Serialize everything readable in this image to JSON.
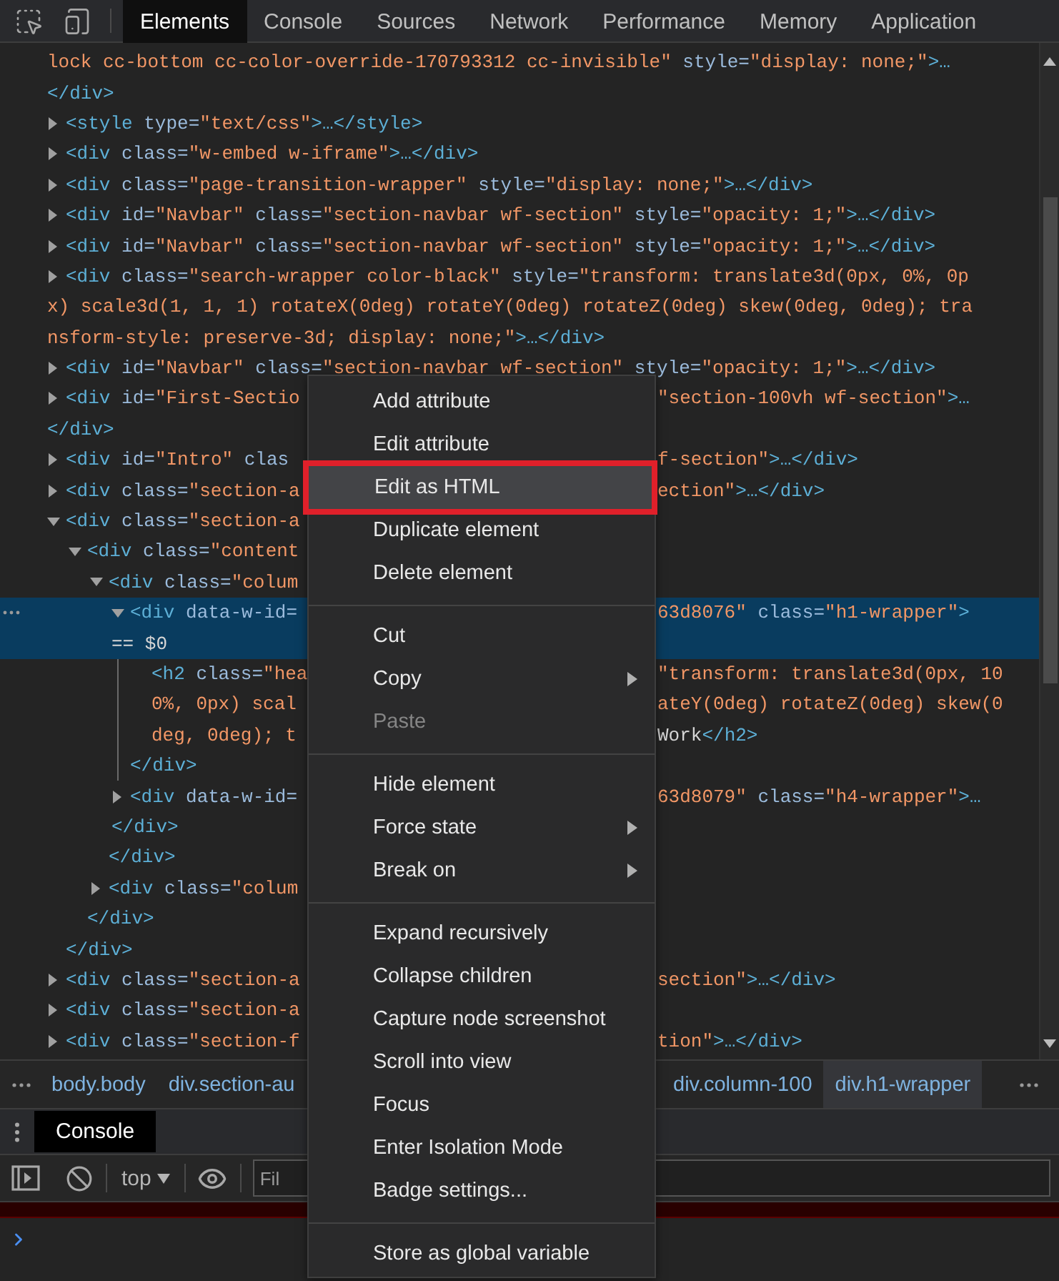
{
  "tabs": [
    {
      "label": "Elements",
      "selected": true
    },
    {
      "label": "Console",
      "selected": false
    },
    {
      "label": "Sources",
      "selected": false
    },
    {
      "label": "Network",
      "selected": false
    },
    {
      "label": "Performance",
      "selected": false
    },
    {
      "label": "Memory",
      "selected": false
    },
    {
      "label": "Application",
      "selected": false
    }
  ],
  "dom_tree": [
    {
      "continued": true,
      "selected": false,
      "lines": [
        {
          "left": [
            {
              "kind": "val",
              "text": "lock cc-bottom cc-color-override-170793312 cc-invisible\""
            },
            {
              "kind": "attr",
              "text": " style="
            },
            {
              "kind": "val",
              "text": "\"display: none;\""
            },
            {
              "kind": "tag",
              "text": ">…"
            }
          ]
        },
        {
          "left": [
            {
              "kind": "tag",
              "text": "</div>"
            }
          ]
        }
      ]
    },
    {
      "expanded": false,
      "selected": false,
      "lines": [
        {
          "left": [
            {
              "kind": "tag",
              "text": "<style"
            },
            {
              "kind": "attr",
              "text": " type="
            },
            {
              "kind": "val",
              "text": "\"text/css\""
            },
            {
              "kind": "tag",
              "text": ">…</style>"
            }
          ]
        }
      ]
    },
    {
      "expanded": false,
      "selected": false,
      "lines": [
        {
          "left": [
            {
              "kind": "tag",
              "text": "<div"
            },
            {
              "kind": "attr",
              "text": " class="
            },
            {
              "kind": "val",
              "text": "\"w-embed w-iframe\""
            },
            {
              "kind": "tag",
              "text": ">…</div>"
            }
          ]
        }
      ]
    },
    {
      "expanded": false,
      "selected": false,
      "lines": [
        {
          "left": [
            {
              "kind": "tag",
              "text": "<div"
            },
            {
              "kind": "attr",
              "text": " class="
            },
            {
              "kind": "val",
              "text": "\"page-transition-wrapper\""
            },
            {
              "kind": "attr",
              "text": " style="
            },
            {
              "kind": "val",
              "text": "\"display: none;\""
            },
            {
              "kind": "tag",
              "text": ">…</div>"
            }
          ]
        }
      ]
    },
    {
      "expanded": false,
      "selected": false,
      "lines": [
        {
          "left": [
            {
              "kind": "tag",
              "text": "<div"
            },
            {
              "kind": "attr",
              "text": " id="
            },
            {
              "kind": "val",
              "text": "\"Navbar\""
            },
            {
              "kind": "attr",
              "text": " class="
            },
            {
              "kind": "val",
              "text": "\"section-navbar wf-section\""
            },
            {
              "kind": "attr",
              "text": " style="
            },
            {
              "kind": "val",
              "text": "\"opacity: 1;\""
            },
            {
              "kind": "tag",
              "text": ">…</div>"
            }
          ]
        }
      ]
    },
    {
      "expanded": false,
      "selected": false,
      "lines": [
        {
          "left": [
            {
              "kind": "tag",
              "text": "<div"
            },
            {
              "kind": "attr",
              "text": " id="
            },
            {
              "kind": "val",
              "text": "\"Navbar\""
            },
            {
              "kind": "attr",
              "text": " class="
            },
            {
              "kind": "val",
              "text": "\"section-navbar wf-section\""
            },
            {
              "kind": "attr",
              "text": " style="
            },
            {
              "kind": "val",
              "text": "\"opacity: 1;\""
            },
            {
              "kind": "tag",
              "text": ">…</div>"
            }
          ]
        }
      ]
    },
    {
      "expanded": false,
      "selected": false,
      "lines": [
        {
          "left": [
            {
              "kind": "tag",
              "text": "<div"
            },
            {
              "kind": "attr",
              "text": " class="
            },
            {
              "kind": "val",
              "text": "\"search-wrapper color-black\""
            },
            {
              "kind": "attr",
              "text": " style="
            },
            {
              "kind": "val",
              "text": "\"transform: translate3d(0px, 0%, 0p"
            }
          ]
        },
        {
          "left": [
            {
              "kind": "val",
              "text": "x) scale3d(1, 1, 1) rotateX(0deg) rotateY(0deg) rotateZ(0deg) skew(0deg, 0deg); tra"
            }
          ]
        },
        {
          "left": [
            {
              "kind": "val",
              "text": "nsform-style: preserve-3d; display: none;\""
            },
            {
              "kind": "tag",
              "text": ">…</div>"
            }
          ]
        }
      ]
    },
    {
      "expanded": false,
      "selected": false,
      "lines": [
        {
          "left": [
            {
              "kind": "tag",
              "text": "<div"
            },
            {
              "kind": "attr",
              "text": " id="
            },
            {
              "kind": "val",
              "text": "\"Navbar\""
            },
            {
              "kind": "attr",
              "text": " class="
            },
            {
              "kind": "val",
              "text": "\"section-navbar wf-section\""
            },
            {
              "kind": "attr",
              "text": " style="
            },
            {
              "kind": "val",
              "text": "\"opacity: 1;\""
            },
            {
              "kind": "tag",
              "text": ">…</div>"
            }
          ]
        }
      ]
    },
    {
      "expanded": false,
      "selected": false,
      "lines": [
        {
          "left": [
            {
              "kind": "tag",
              "text": "<div"
            },
            {
              "kind": "attr",
              "text": " id="
            },
            {
              "kind": "val",
              "text": "\"First-Sectio"
            }
          ],
          "right": [
            {
              "kind": "val",
              "text": "\"section-100vh wf-section\""
            },
            {
              "kind": "tag",
              "text": ">…"
            }
          ]
        },
        {
          "left": [
            {
              "kind": "tag",
              "text": "</div>"
            }
          ]
        }
      ]
    },
    {
      "expanded": false,
      "selected": false,
      "lines": [
        {
          "left": [
            {
              "kind": "tag",
              "text": "<div"
            },
            {
              "kind": "attr",
              "text": " id="
            },
            {
              "kind": "val",
              "text": "\"Intro\""
            },
            {
              "kind": "attr",
              "text": " clas"
            }
          ],
          "right": [
            {
              "kind": "val",
              "text": "f-section\""
            },
            {
              "kind": "tag",
              "text": ">…</div>"
            }
          ]
        }
      ]
    },
    {
      "expanded": false,
      "selected": false,
      "lines": [
        {
          "left": [
            {
              "kind": "tag",
              "text": "<div"
            },
            {
              "kind": "attr",
              "text": " class="
            },
            {
              "kind": "val",
              "text": "\"section-a"
            }
          ],
          "right": [
            {
              "kind": "val",
              "text": "ection\""
            },
            {
              "kind": "tag",
              "text": ">…</div>"
            }
          ]
        }
      ]
    },
    {
      "expanded": true,
      "selected": false,
      "lines": [
        {
          "left": [
            {
              "kind": "tag",
              "text": "<div"
            },
            {
              "kind": "attr",
              "text": " class="
            },
            {
              "kind": "val",
              "text": "\"section-a"
            }
          ]
        }
      ],
      "close": [
        {
          "kind": "tag",
          "text": "</div>"
        }
      ],
      "children": [
        {
          "expanded": true,
          "selected": false,
          "lines": [
            {
              "left": [
                {
                  "kind": "tag",
                  "text": "<div"
                },
                {
                  "kind": "attr",
                  "text": " class="
                },
                {
                  "kind": "val",
                  "text": "\"content"
                }
              ]
            }
          ],
          "close": [
            {
              "kind": "tag",
              "text": "</div>"
            }
          ],
          "children": [
            {
              "expanded": true,
              "selected": false,
              "lines": [
                {
                  "left": [
                    {
                      "kind": "tag",
                      "text": "<div"
                    },
                    {
                      "kind": "attr",
                      "text": " class="
                    },
                    {
                      "kind": "val",
                      "text": "\"colum"
                    }
                  ]
                }
              ],
              "close": [
                {
                  "kind": "tag",
                  "text": "</div>"
                }
              ],
              "children": [
                {
                  "expanded": true,
                  "selected": true,
                  "lines": [
                    {
                      "left": [
                        {
                          "kind": "tag",
                          "text": "<div"
                        },
                        {
                          "kind": "attr",
                          "text": " data-w-id="
                        }
                      ],
                      "right": [
                        {
                          "kind": "val",
                          "text": "63d8076\""
                        },
                        {
                          "kind": "attr",
                          "text": " class="
                        },
                        {
                          "kind": "val",
                          "text": "\"h1-wrapper\""
                        },
                        {
                          "kind": "tag",
                          "text": ">"
                        }
                      ]
                    },
                    {
                      "left": [
                        {
                          "kind": "text",
                          "text": "== $0"
                        }
                      ]
                    }
                  ],
                  "close": [
                    {
                      "kind": "tag",
                      "text": "</div>"
                    }
                  ],
                  "children": [
                    {
                      "selected": false,
                      "lines": [
                        {
                          "left": [
                            {
                              "kind": "tag",
                              "text": "<h2"
                            },
                            {
                              "kind": "attr",
                              "text": " class="
                            },
                            {
                              "kind": "val",
                              "text": "\"hea"
                            }
                          ],
                          "right": [
                            {
                              "kind": "val",
                              "text": "\"transform: translate3d(0px, 10"
                            }
                          ]
                        },
                        {
                          "left": [
                            {
                              "kind": "val",
                              "text": "0%, 0px) scal"
                            }
                          ],
                          "right": [
                            {
                              "kind": "val",
                              "text": "ateY(0deg) rotateZ(0deg) skew(0"
                            }
                          ]
                        },
                        {
                          "left": [
                            {
                              "kind": "val",
                              "text": "deg, 0deg); t"
                            }
                          ],
                          "right": [
                            {
                              "kind": "text",
                              "text": "Work"
                            },
                            {
                              "kind": "tag",
                              "text": "</h2>"
                            }
                          ]
                        }
                      ]
                    }
                  ]
                },
                {
                  "expanded": false,
                  "selected": false,
                  "lines": [
                    {
                      "left": [
                        {
                          "kind": "tag",
                          "text": "<div"
                        },
                        {
                          "kind": "attr",
                          "text": " data-w-id="
                        }
                      ],
                      "right": [
                        {
                          "kind": "val",
                          "text": "63d8079\""
                        },
                        {
                          "kind": "attr",
                          "text": " class="
                        },
                        {
                          "kind": "val",
                          "text": "\"h4-wrapper\""
                        },
                        {
                          "kind": "tag",
                          "text": ">…"
                        }
                      ]
                    },
                    {
                      "left": [
                        {
                          "kind": "tag",
                          "text": "</div>"
                        }
                      ]
                    }
                  ]
                }
              ]
            },
            {
              "expanded": false,
              "selected": false,
              "lines": [
                {
                  "left": [
                    {
                      "kind": "tag",
                      "text": "<div"
                    },
                    {
                      "kind": "attr",
                      "text": " class="
                    },
                    {
                      "kind": "val",
                      "text": "\"colum"
                    }
                  ]
                }
              ]
            }
          ]
        }
      ]
    },
    {
      "expanded": false,
      "selected": false,
      "lines": [
        {
          "left": [
            {
              "kind": "tag",
              "text": "<div"
            },
            {
              "kind": "attr",
              "text": " class="
            },
            {
              "kind": "val",
              "text": "\"section-a"
            }
          ],
          "right": [
            {
              "kind": "val",
              "text": "section\""
            },
            {
              "kind": "tag",
              "text": ">…</div>"
            }
          ]
        }
      ]
    },
    {
      "expanded": false,
      "selected": false,
      "lines": [
        {
          "left": [
            {
              "kind": "tag",
              "text": "<div"
            },
            {
              "kind": "attr",
              "text": " class="
            },
            {
              "kind": "val",
              "text": "\"section-a"
            }
          ]
        }
      ]
    },
    {
      "expanded": false,
      "selected": false,
      "lines": [
        {
          "left": [
            {
              "kind": "tag",
              "text": "<div"
            },
            {
              "kind": "attr",
              "text": " class="
            },
            {
              "kind": "val",
              "text": "\"section-f"
            }
          ],
          "right": [
            {
              "kind": "val",
              "text": "tion\""
            },
            {
              "kind": "tag",
              "text": ">…</div>"
            }
          ]
        }
      ]
    }
  ],
  "breadcrumbs": {
    "left": [
      {
        "label": "body.body",
        "selected": false
      },
      {
        "label": "div.section-au",
        "selected": false
      }
    ],
    "right": [
      {
        "label": "div.column-100",
        "selected": false
      },
      {
        "label": "div.h1-wrapper",
        "selected": true
      }
    ]
  },
  "drawer": {
    "tabs": [
      {
        "label": "Console",
        "selected": true
      }
    ],
    "context": "top",
    "filter": {
      "placeholder": "Fil"
    }
  },
  "context_menu": {
    "items": [
      {
        "kind": "item",
        "label": "Add attribute",
        "disabled": false,
        "submenu": false,
        "highlighted": false
      },
      {
        "kind": "item",
        "label": "Edit attribute",
        "disabled": false,
        "submenu": false,
        "highlighted": false
      },
      {
        "kind": "item",
        "label": "Edit as HTML",
        "disabled": false,
        "submenu": false,
        "highlighted": true
      },
      {
        "kind": "item",
        "label": "Duplicate element",
        "disabled": false,
        "submenu": false,
        "highlighted": false
      },
      {
        "kind": "item",
        "label": "Delete element",
        "disabled": false,
        "submenu": false,
        "highlighted": false
      },
      {
        "kind": "separator"
      },
      {
        "kind": "item",
        "label": "Cut",
        "disabled": false,
        "submenu": false,
        "highlighted": false
      },
      {
        "kind": "item",
        "label": "Copy",
        "disabled": false,
        "submenu": true,
        "highlighted": false
      },
      {
        "kind": "item",
        "label": "Paste",
        "disabled": true,
        "submenu": false,
        "highlighted": false
      },
      {
        "kind": "separator"
      },
      {
        "kind": "item",
        "label": "Hide element",
        "disabled": false,
        "submenu": false,
        "highlighted": false
      },
      {
        "kind": "item",
        "label": "Force state",
        "disabled": false,
        "submenu": true,
        "highlighted": false
      },
      {
        "kind": "item",
        "label": "Break on",
        "disabled": false,
        "submenu": true,
        "highlighted": false
      },
      {
        "kind": "separator"
      },
      {
        "kind": "item",
        "label": "Expand recursively",
        "disabled": false,
        "submenu": false,
        "highlighted": false
      },
      {
        "kind": "item",
        "label": "Collapse children",
        "disabled": false,
        "submenu": false,
        "highlighted": false
      },
      {
        "kind": "item",
        "label": "Capture node screenshot",
        "disabled": false,
        "submenu": false,
        "highlighted": false
      },
      {
        "kind": "item",
        "label": "Scroll into view",
        "disabled": false,
        "submenu": false,
        "highlighted": false
      },
      {
        "kind": "item",
        "label": "Focus",
        "disabled": false,
        "submenu": false,
        "highlighted": false
      },
      {
        "kind": "item",
        "label": "Enter Isolation Mode",
        "disabled": false,
        "submenu": false,
        "highlighted": false
      },
      {
        "kind": "item",
        "label": "Badge settings...",
        "disabled": false,
        "submenu": false,
        "highlighted": false
      },
      {
        "kind": "separator"
      },
      {
        "kind": "item",
        "label": "Store as global variable",
        "disabled": false,
        "submenu": false,
        "highlighted": false
      }
    ]
  }
}
